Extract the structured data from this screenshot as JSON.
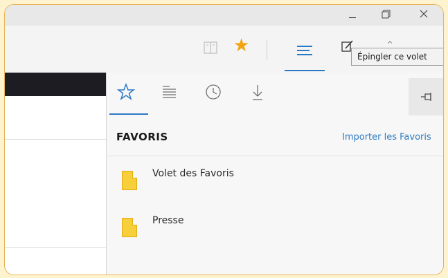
{
  "window": {
    "controls": {
      "minimize_icon": "minimize-icon",
      "maximize_icon": "restore-icon",
      "close_icon": "close-icon"
    }
  },
  "toolbar": {
    "icons": [
      "reading-view-icon",
      "favorites-star-icon",
      "hub-icon",
      "web-note-icon"
    ],
    "accent_color": "#2b78c5",
    "star_color": "#f2a30f"
  },
  "tooltip": {
    "text": "Épingler ce volet"
  },
  "hub": {
    "tabs": [
      {
        "icon": "favorites-star-icon",
        "active": true
      },
      {
        "icon": "reading-list-icon",
        "active": false
      },
      {
        "icon": "history-icon",
        "active": false
      },
      {
        "icon": "downloads-icon",
        "active": false
      }
    ],
    "pin_icon": "pin-icon",
    "section_title": "FAVORIS",
    "import_link": "Importer les Favoris",
    "items": [
      {
        "label": "Volet des Favoris",
        "icon": "folder-icon"
      },
      {
        "label": "Presse",
        "icon": "folder-icon"
      }
    ]
  },
  "colors": {
    "folder": "#f6cf3a",
    "link": "#2e7cc0",
    "frame_border": "#e8b35a"
  }
}
